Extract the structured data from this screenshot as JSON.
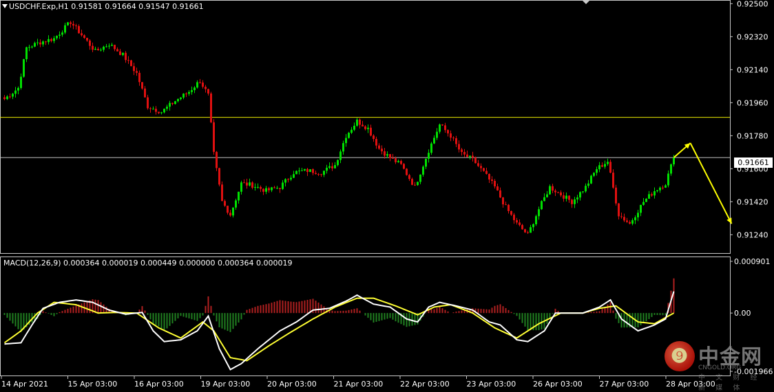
{
  "title": {
    "symbol_line": "USDCHF.Exp,H1  0.91581  0.91664  0.91547  0.91661",
    "macd_line": "MACD(12,26,9) 0.000364 0.000019 0.000449 0.000000 0.000364 0.000019"
  },
  "current_price_label": "0.91661",
  "watermark": {
    "icon_glyph": "❾",
    "name": "中金网",
    "domain": "CNGOLD.ORG",
    "tagline": "中 文 财 经 新 媒 体"
  },
  "colors": {
    "background": "#000000",
    "bull": "#00e000",
    "bear": "#e01010",
    "grid_frame": "#c8c8c8",
    "support_line": "#e8e800",
    "price_line": "#c0c0c0",
    "macd_line": "#ffffff",
    "signal_line": "#ffff33",
    "hist_pos": "#b02020",
    "hist_neg": "#208020",
    "arrow": "#ffff00"
  },
  "chart_data": [
    {
      "type": "candlestick",
      "panel": "main",
      "ylim": [
        0.9114,
        0.9252
      ],
      "y_ticks": [
        "0.92500",
        "0.92320",
        "0.92140",
        "0.91960",
        "0.91780",
        "0.91600",
        "0.91420",
        "0.91240"
      ],
      "x_ticks": [
        "14 Apr 2021",
        "15 Apr 03:00",
        "16 Apr 03:00",
        "19 Apr 03:00",
        "20 Apr 03:00",
        "21 Apr 03:00",
        "22 Apr 03:00",
        "23 Apr 03:00",
        "26 Apr 03:00",
        "27 Apr 03:00",
        "28 Apr 03:00"
      ],
      "horizontal_lines": [
        {
          "name": "support-resistance",
          "value": 0.9188
        },
        {
          "name": "current-price",
          "value": 0.91661
        }
      ],
      "anchor_closes": [
        [
          0,
          0.9198
        ],
        [
          5,
          0.9204
        ],
        [
          8,
          0.9226
        ],
        [
          13,
          0.9229
        ],
        [
          18,
          0.9231
        ],
        [
          24,
          0.924
        ],
        [
          28,
          0.9233
        ],
        [
          33,
          0.9224
        ],
        [
          38,
          0.9228
        ],
        [
          43,
          0.9222
        ],
        [
          48,
          0.9212
        ],
        [
          52,
          0.9194
        ],
        [
          57,
          0.9191
        ],
        [
          62,
          0.9197
        ],
        [
          67,
          0.9202
        ],
        [
          71,
          0.9208
        ],
        [
          74,
          0.92
        ],
        [
          76,
          0.9168
        ],
        [
          79,
          0.9142
        ],
        [
          82,
          0.9135
        ],
        [
          86,
          0.9152
        ],
        [
          90,
          0.9151
        ],
        [
          95,
          0.9148
        ],
        [
          100,
          0.915
        ],
        [
          105,
          0.9158
        ],
        [
          110,
          0.9159
        ],
        [
          115,
          0.9158
        ],
        [
          120,
          0.9162
        ],
        [
          124,
          0.9178
        ],
        [
          128,
          0.9186
        ],
        [
          132,
          0.9182
        ],
        [
          136,
          0.9171
        ],
        [
          140,
          0.9166
        ],
        [
          144,
          0.9162
        ],
        [
          149,
          0.915
        ],
        [
          154,
          0.917
        ],
        [
          158,
          0.9184
        ],
        [
          162,
          0.9178
        ],
        [
          166,
          0.9168
        ],
        [
          170,
          0.9165
        ],
        [
          174,
          0.9158
        ],
        [
          178,
          0.915
        ],
        [
          182,
          0.9139
        ],
        [
          186,
          0.913
        ],
        [
          190,
          0.9124
        ],
        [
          194,
          0.9138
        ],
        [
          198,
          0.915
        ],
        [
          202,
          0.9146
        ],
        [
          206,
          0.9142
        ],
        [
          211,
          0.915
        ],
        [
          215,
          0.916
        ],
        [
          219,
          0.9164
        ],
        [
          223,
          0.9135
        ],
        [
          227,
          0.913
        ],
        [
          232,
          0.9142
        ],
        [
          236,
          0.9148
        ],
        [
          240,
          0.9152
        ],
        [
          243,
          0.91661
        ]
      ],
      "forecast_arrows": [
        {
          "from_bar": 243,
          "from": 0.91661,
          "to_bar": 249,
          "to": 0.9174
        },
        {
          "from_bar": 249,
          "from": 0.9174,
          "to_bar": 264,
          "to": 0.913
        }
      ]
    },
    {
      "type": "macd",
      "panel": "sub",
      "params": "12,26,9",
      "ylim": [
        -0.00105,
        0.00095
      ],
      "y_ticks": [
        "0.000901",
        "0.00",
        "-0.001966"
      ],
      "series": [
        {
          "name": "MACD",
          "anchors": [
            [
              0,
              -0.00052
            ],
            [
              6,
              -0.0005
            ],
            [
              10,
              -0.0002
            ],
            [
              14,
              8e-05
            ],
            [
              20,
              0.00018
            ],
            [
              26,
              0.00022
            ],
            [
              32,
              0.00018
            ],
            [
              38,
              5e-05
            ],
            [
              44,
              -2e-05
            ],
            [
              50,
              1e-05
            ],
            [
              54,
              -0.0003
            ],
            [
              58,
              -0.00048
            ],
            [
              64,
              -0.00045
            ],
            [
              70,
              -0.0003
            ],
            [
              74,
              -5e-05
            ],
            [
              78,
              -0.0006
            ],
            [
              82,
              -0.00095
            ],
            [
              86,
              -0.00085
            ],
            [
              92,
              -0.0006
            ],
            [
              100,
              -0.0003
            ],
            [
              106,
              -0.00015
            ],
            [
              112,
              5e-05
            ],
            [
              118,
              8e-05
            ],
            [
              124,
              0.0002
            ],
            [
              128,
              0.0003
            ],
            [
              134,
              0.00015
            ],
            [
              140,
              0.0001
            ],
            [
              146,
              -0.0001
            ],
            [
              150,
              -0.00015
            ],
            [
              154,
              0.0001
            ],
            [
              158,
              0.00018
            ],
            [
              164,
              0.00012
            ],
            [
              170,
              5e-05
            ],
            [
              176,
              -0.00015
            ],
            [
              180,
              -0.0002
            ],
            [
              186,
              -0.00045
            ],
            [
              190,
              -0.00048
            ],
            [
              196,
              -0.0003
            ],
            [
              200,
              0.0
            ],
            [
              204,
              0.0
            ],
            [
              210,
              0.0
            ],
            [
              216,
              0.0001
            ],
            [
              220,
              0.00022
            ],
            [
              224,
              -0.0001
            ],
            [
              230,
              -0.0003
            ],
            [
              236,
              -0.0002
            ],
            [
              240,
              -0.0001
            ],
            [
              243,
              0.000364
            ]
          ]
        },
        {
          "name": "Signal",
          "anchors": [
            [
              0,
              -0.0005
            ],
            [
              6,
              -0.0003
            ],
            [
              12,
              0.0
            ],
            [
              18,
              0.00018
            ],
            [
              26,
              0.00014
            ],
            [
              34,
              0.0
            ],
            [
              40,
              1e-05
            ],
            [
              48,
              0.0
            ],
            [
              56,
              -0.00025
            ],
            [
              64,
              -0.00042
            ],
            [
              72,
              -0.00015
            ],
            [
              76,
              -0.0003
            ],
            [
              82,
              -0.00075
            ],
            [
              88,
              -0.0008
            ],
            [
              96,
              -0.00055
            ],
            [
              104,
              -0.00032
            ],
            [
              112,
              -0.0001
            ],
            [
              120,
              0.0001
            ],
            [
              128,
              0.00025
            ],
            [
              134,
              0.00025
            ],
            [
              142,
              0.00012
            ],
            [
              150,
              -3e-05
            ],
            [
              156,
              0.0001
            ],
            [
              162,
              0.00014
            ],
            [
              170,
              0.0
            ],
            [
              178,
              -0.00025
            ],
            [
              186,
              -0.00042
            ],
            [
              194,
              -0.00018
            ],
            [
              202,
              0.0
            ],
            [
              210,
              0.0
            ],
            [
              216,
              8e-05
            ],
            [
              222,
              0.00012
            ],
            [
              230,
              -0.00015
            ],
            [
              236,
              -0.00018
            ],
            [
              243,
              0.0
            ]
          ]
        }
      ]
    }
  ]
}
